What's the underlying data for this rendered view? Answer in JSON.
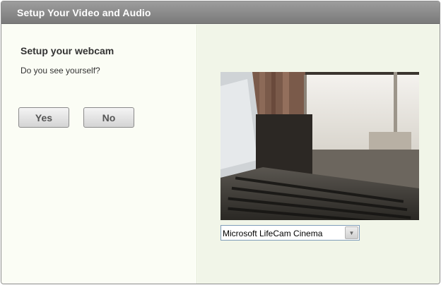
{
  "window": {
    "title": "Setup Your Video and Audio"
  },
  "setup": {
    "heading": "Setup your webcam",
    "prompt": "Do you see yourself?",
    "yes_label": "Yes",
    "no_label": "No"
  },
  "camera": {
    "selected_device": "Microsoft LifeCam Cinema",
    "dropdown_icon": "chevron-down-icon"
  },
  "colors": {
    "titlebar": "#8a8a8a",
    "left_pane": "#fbfdf5",
    "right_pane": "#f1f5e8"
  }
}
